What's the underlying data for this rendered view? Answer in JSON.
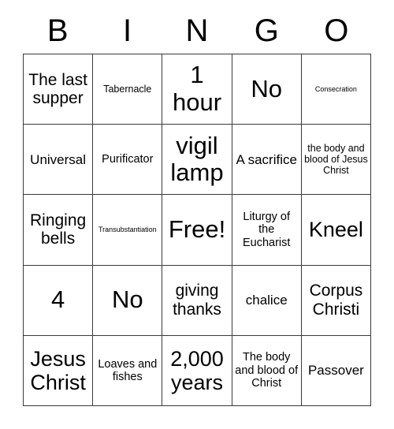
{
  "card": {
    "headers": [
      "B",
      "I",
      "N",
      "G",
      "O"
    ],
    "rows": [
      [
        {
          "text": "The last supper",
          "size": "fs-l"
        },
        {
          "text": "Tabernacle",
          "size": "fs-xs"
        },
        {
          "text": "1 hour",
          "size": "fs-xxl"
        },
        {
          "text": "No",
          "size": "fs-xxl"
        },
        {
          "text": "Consecration",
          "size": "fs-xxs"
        }
      ],
      [
        {
          "text": "Universal",
          "size": "fs-m"
        },
        {
          "text": "Purificator",
          "size": "fs-s"
        },
        {
          "text": "vigil lamp",
          "size": "fs-xxl"
        },
        {
          "text": "A sacrifice",
          "size": "fs-m"
        },
        {
          "text": "the body and blood of Jesus Christ",
          "size": "fs-xs"
        }
      ],
      [
        {
          "text": "Ringing bells",
          "size": "fs-l"
        },
        {
          "text": "Transubstantiation",
          "size": "fs-xxs"
        },
        {
          "text": "Free!",
          "size": "fs-xxl"
        },
        {
          "text": "Liturgy of the Eucharist",
          "size": "fs-s"
        },
        {
          "text": "Kneel",
          "size": "fs-xl"
        }
      ],
      [
        {
          "text": "4",
          "size": "fs-xxl"
        },
        {
          "text": "No",
          "size": "fs-xxl"
        },
        {
          "text": "giving thanks",
          "size": "fs-l"
        },
        {
          "text": "chalice",
          "size": "fs-m"
        },
        {
          "text": "Corpus Christi",
          "size": "fs-l"
        }
      ],
      [
        {
          "text": "Jesus Christ",
          "size": "fs-xl"
        },
        {
          "text": "Loaves and fishes",
          "size": "fs-s"
        },
        {
          "text": "2,000 years",
          "size": "fs-xl"
        },
        {
          "text": "The body and blood of Christ",
          "size": "fs-s"
        },
        {
          "text": "Passover",
          "size": "fs-m"
        }
      ]
    ]
  },
  "colors": {
    "background": "#ffffff",
    "text": "#000000",
    "border": "#3a3a3a"
  }
}
